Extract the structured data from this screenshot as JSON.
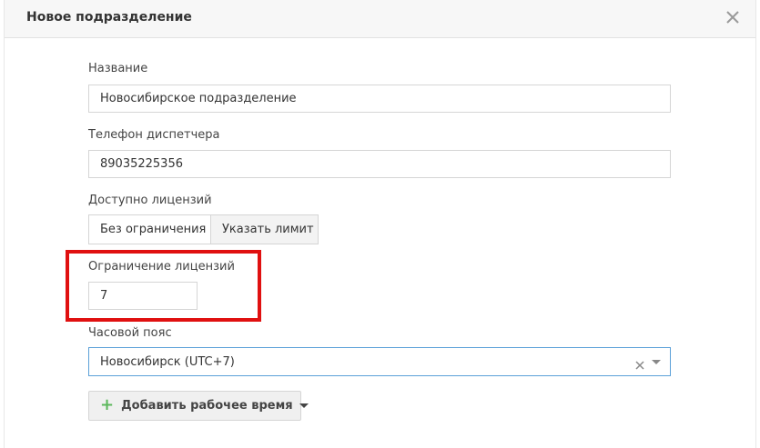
{
  "modal": {
    "title": "Новое подразделение"
  },
  "form": {
    "name": {
      "label": "Название",
      "value": "Новосибирское подразделение"
    },
    "phone": {
      "label": "Телефон диспетчера",
      "value": "89035225356"
    },
    "licenses": {
      "label": "Доступно лицензий",
      "options": [
        "Без ограничения",
        "Указать лимит"
      ],
      "selected": "Без ограничения"
    },
    "license_limit": {
      "label": "Ограничение лицензий",
      "value": "7"
    },
    "timezone": {
      "label": "Часовой пояс",
      "value": "Новосибирск (UTC+7)"
    },
    "add_time_button": {
      "label": "Добавить рабочее время"
    }
  },
  "colors": {
    "highlight": "#e01010",
    "plus": "#5cb85c",
    "focus_border": "#5aa0d8"
  },
  "icons": [
    "close-icon",
    "clear-icon",
    "dropdown-arrow-icon",
    "plus-icon",
    "caret-down-icon"
  ]
}
